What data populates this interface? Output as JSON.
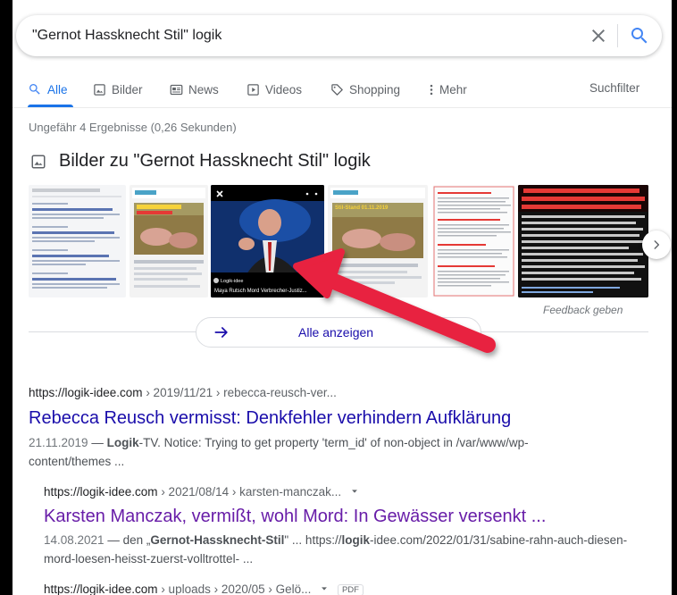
{
  "search": {
    "query": "\"Gernot Hassknecht Stil\" logik"
  },
  "tabs": [
    {
      "label": "Alle",
      "icon": "search-icon"
    },
    {
      "label": "Bilder",
      "icon": "image-icon"
    },
    {
      "label": "News",
      "icon": "news-icon"
    },
    {
      "label": "Videos",
      "icon": "play-icon"
    },
    {
      "label": "Shopping",
      "icon": "tag-icon"
    },
    {
      "label": "Mehr",
      "icon": "more-vert-icon"
    }
  ],
  "tools_label": "Suchfilter",
  "result_stats": "Ungefähr 4 Ergebnisse (0,26 Sekunden)",
  "images": {
    "title": "Bilder zu \"Gernot Hassknecht Stil\" logik",
    "thumb_captions": {
      "t2": "Stil-Stand 01.11.2019",
      "t3_source": "Logik-idee",
      "t3_title": "Maya Rutsch Mord Verbrecher-Justiz...",
      "t6_headline": "n Muddis: Handydaten eines ANRUFS WÄHR dessen hofse zu ZEIT und ZEIT dabei dir rer im Fall Rebecca Reusch ist man genau das"
    },
    "feedback": "Feedback geben",
    "show_all": "Alle anzeigen"
  },
  "results": [
    {
      "cite_domain": "https://logik-idee.com",
      "cite_path": " › 2019/11/21 › rebecca-reusch-ver...",
      "title": "Rebecca Reusch vermisst: Denkfehler verhindern Aufklärung",
      "date": "21.11.2019",
      "snippet_pre": " — ",
      "snippet_bold": "Logik",
      "snippet_post": "-TV. Notice: Trying to get property 'term_id' of non-object in /var/www/wp-content/themes ..."
    },
    {
      "cite_domain": "https://logik-idee.com",
      "cite_path": " › 2021/08/14 › karsten-manczak...",
      "title": "Karsten Manczak, vermißt, wohl Mord: In Gewässer versenkt ...",
      "date": "14.08.2021",
      "snippet_a": " — den „",
      "snippet_b": "Gernot-Hassknecht-Stil",
      "snippet_c": "\" ... https://",
      "snippet_d": "logik",
      "snippet_e": "-idee.com/2022/01/31/sabine-rahn-auch-diesen-mord-loesen-heisst-zuerst-volltrottel- ..."
    },
    {
      "cite_domain": "https://logik-idee.com",
      "cite_path": " › uploads › 2020/05 › Gelö...",
      "badge": "PDF"
    }
  ],
  "colors": {
    "link": "#1a0dab",
    "visited": "#681da8",
    "accent": "#1a73e8",
    "overlay_arrow": "#e8213f"
  }
}
